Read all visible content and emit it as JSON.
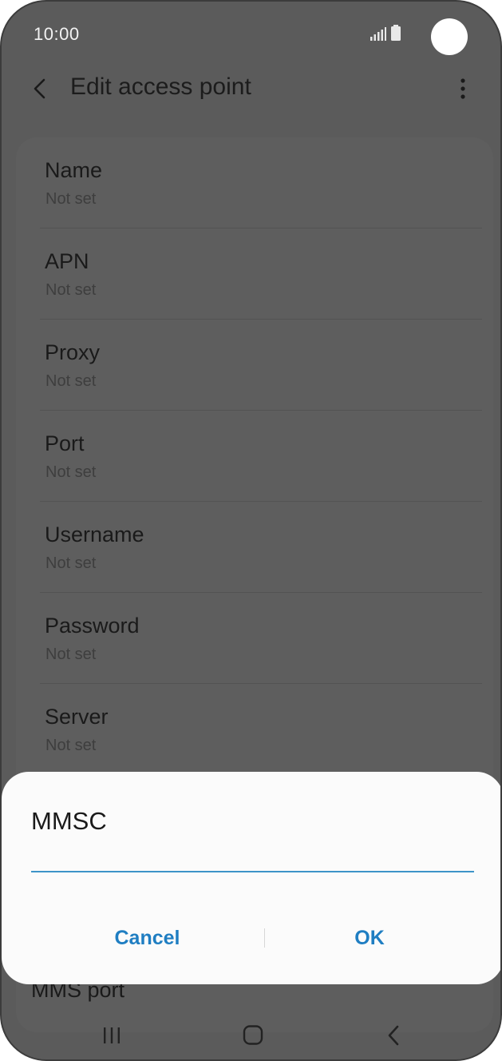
{
  "status_bar": {
    "time": "10:00",
    "icons": [
      "signal-icon",
      "battery-icon"
    ]
  },
  "app_bar": {
    "title": "Edit access point",
    "back_icon": "back-arrow-icon",
    "menu_icon": "more-options-icon"
  },
  "settings": {
    "items": [
      {
        "title": "Name",
        "value": "Not set"
      },
      {
        "title": "APN",
        "value": "Not set"
      },
      {
        "title": "Proxy",
        "value": "Not set"
      },
      {
        "title": "Port",
        "value": "Not set"
      },
      {
        "title": "Username",
        "value": "Not set"
      },
      {
        "title": "Password",
        "value": "Not set"
      },
      {
        "title": "Server",
        "value": "Not set"
      }
    ],
    "peek_item": "MMS port"
  },
  "dialog": {
    "title": "MMSC",
    "input_value": "",
    "cancel_label": "Cancel",
    "ok_label": "OK"
  },
  "nav_bar": {
    "icons": [
      "recents-icon",
      "home-icon",
      "back-icon"
    ]
  },
  "colors": {
    "accent": "#1f7ec2",
    "input_underline": "#3d94c8",
    "scrim_background": "#5b5b5b",
    "dialog_background": "#fbfbfb"
  }
}
